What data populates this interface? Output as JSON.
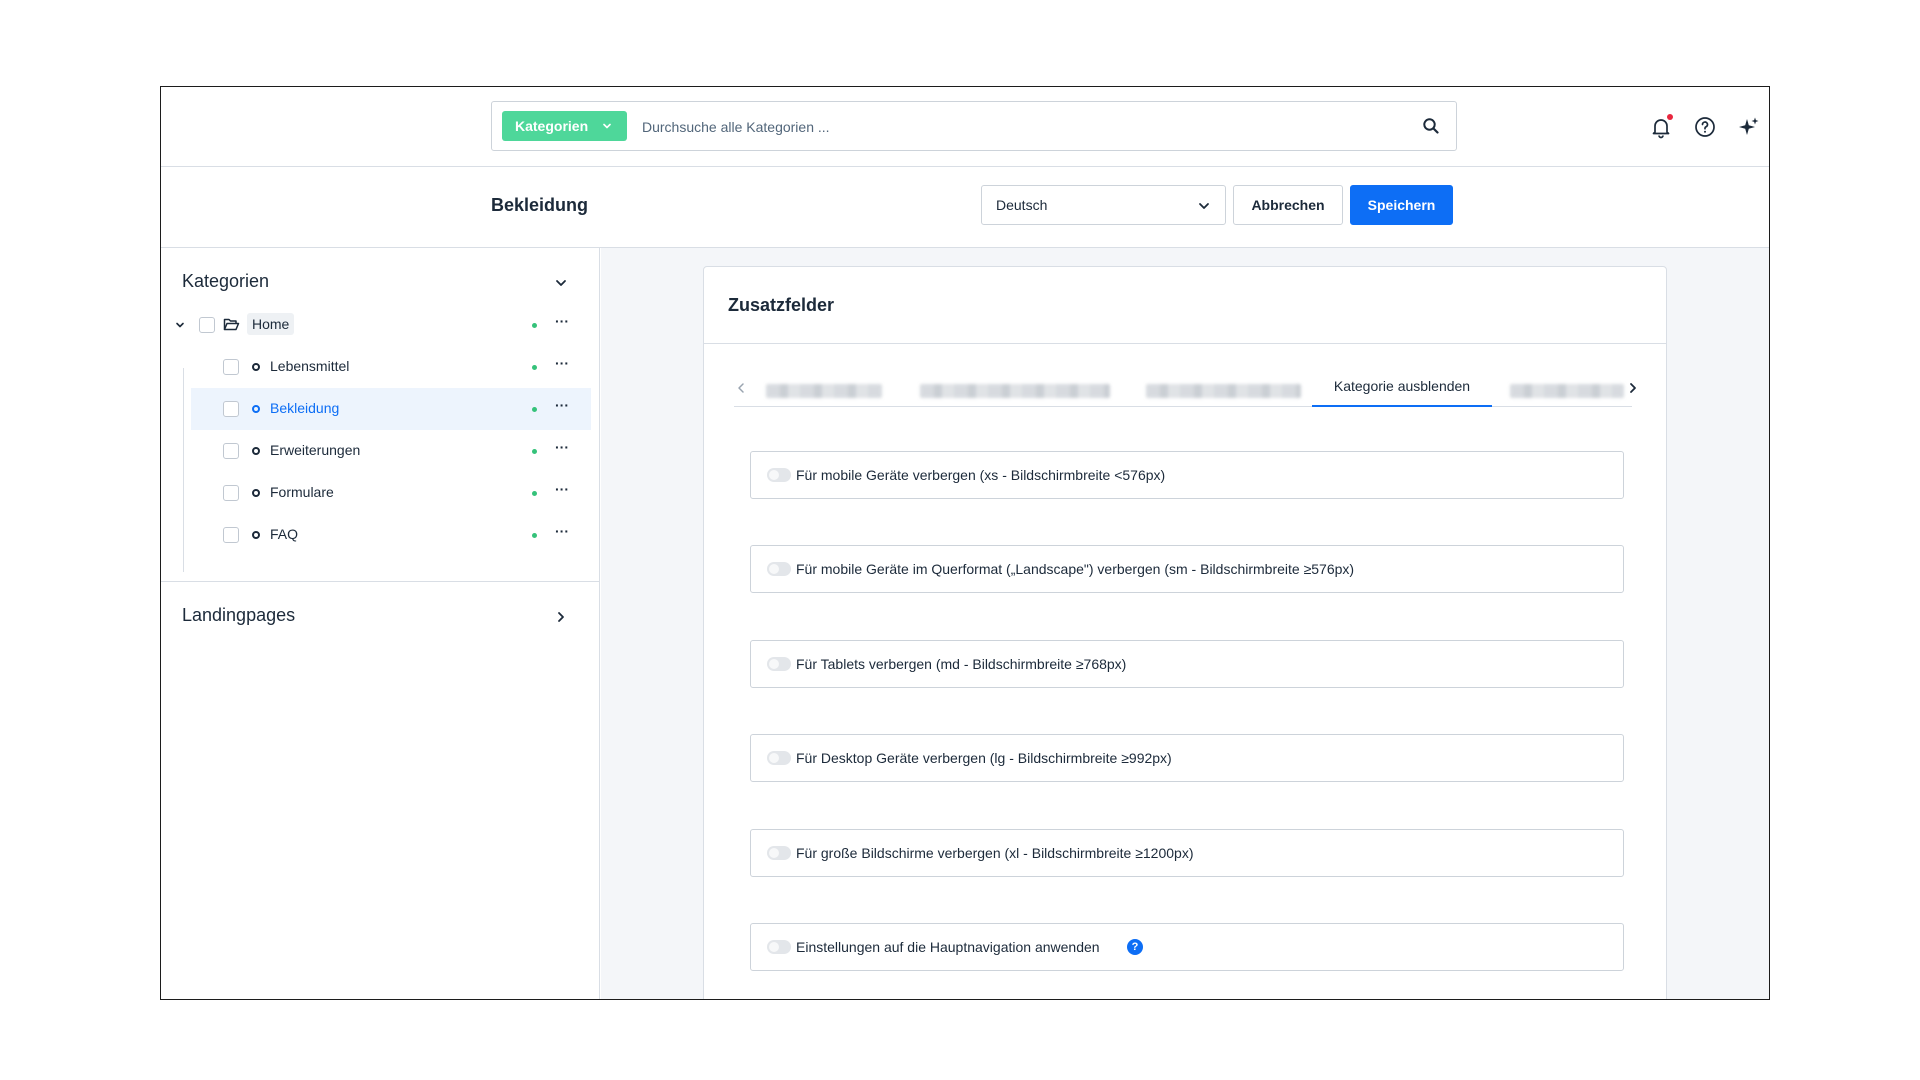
{
  "search": {
    "type_label": "Kategorien",
    "placeholder": "Durchsuche alle Kategorien ..."
  },
  "top_icons": [
    "bell-icon",
    "help-circle-icon",
    "sparkle-icon"
  ],
  "header": {
    "title": "Bekleidung",
    "language": "Deutsch",
    "cancel_label": "Abbrechen",
    "save_label": "Speichern"
  },
  "sidebar": {
    "categories_title": "Kategorien",
    "tree": {
      "root": "Home",
      "children": [
        {
          "label": "Lebensmittel"
        },
        {
          "label": "Bekleidung"
        },
        {
          "label": "Erweiterungen"
        },
        {
          "label": "Formulare"
        },
        {
          "label": "FAQ"
        }
      ]
    },
    "landingpages_title": "Landingpages"
  },
  "card": {
    "title": "Zusatzfelder",
    "active_tab": "Kategorie ausblenden",
    "toggles": [
      {
        "label": "Für mobile Geräte verbergen (xs - Bildschirmbreite <576px)"
      },
      {
        "label": "Für mobile Geräte im Querformat („Landscape\") verbergen (sm - Bildschirmbreite ≥576px)"
      },
      {
        "label": "Für Tablets verbergen (md - Bildschirmbreite ≥768px)"
      },
      {
        "label": "Für Desktop Geräte verbergen (lg - Bildschirmbreite ≥992px)"
      },
      {
        "label": "Für große Bildschirme verbergen (xl - Bildschirmbreite ≥1200px)"
      },
      {
        "label": "Einstellungen auf die Hauptnavigation anwenden"
      }
    ]
  },
  "colors": {
    "accent_blue": "#0d6ef5",
    "search_type_green": "#4ed79a",
    "status_green": "#35c27a",
    "notification_red": "#e8263e"
  }
}
